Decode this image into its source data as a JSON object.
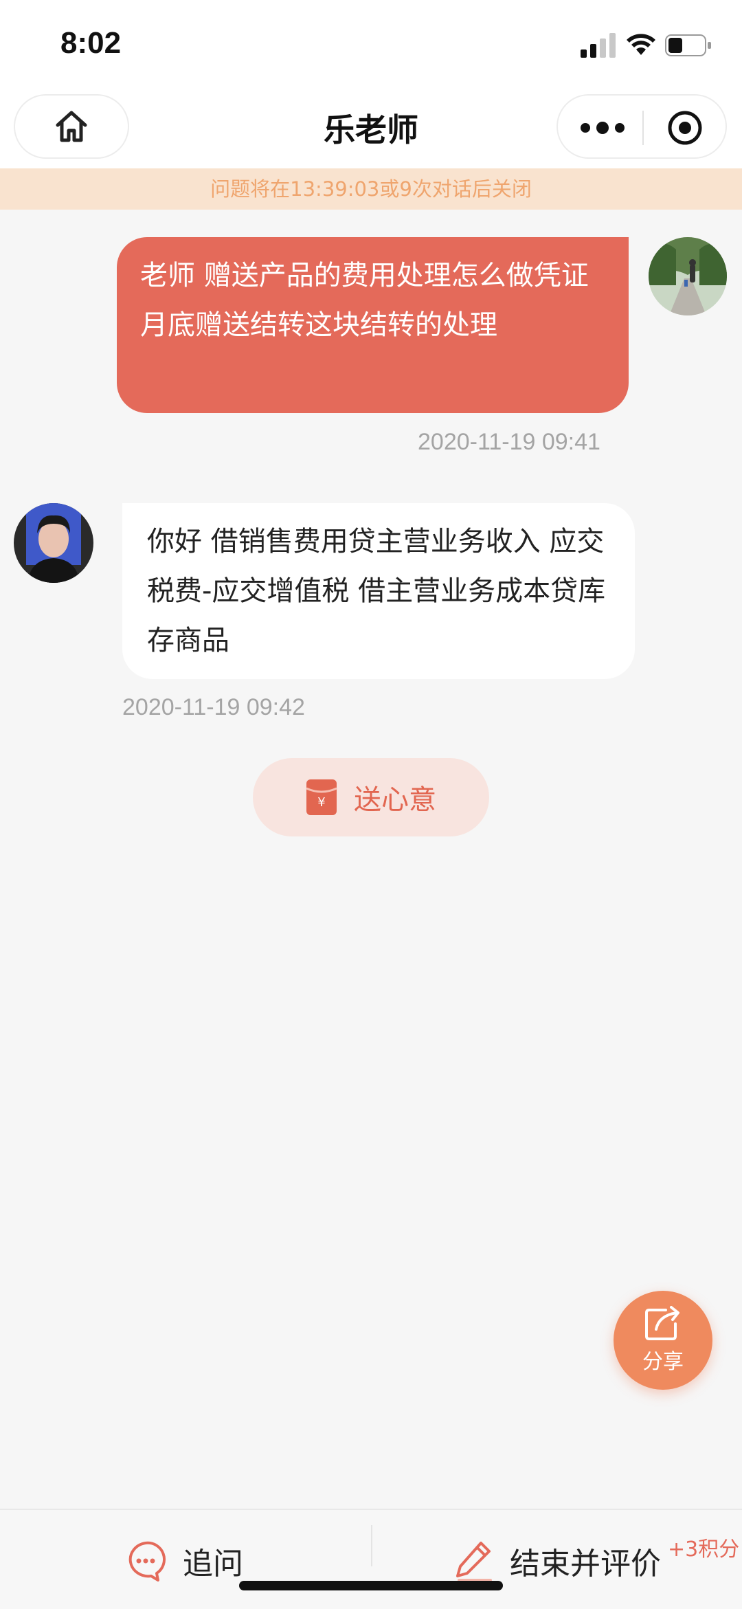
{
  "status_bar": {
    "time": "8:02"
  },
  "nav": {
    "title": "乐老师"
  },
  "notice": {
    "text": "问题将在13:39:03或9次对话后关闭"
  },
  "messages": [
    {
      "sender": "user",
      "text": "老师 赠送产品的费用处理怎么做凭证 月底赠送结转这块结转的处理",
      "time": "2020-11-19 09:41"
    },
    {
      "sender": "teacher",
      "text": " 你好  借销售费用贷主营业务收入  应交税费-应交增值税  借主营业务成本贷库存商品",
      "time": "2020-11-19 09:42"
    }
  ],
  "gift_button": {
    "label": "送心意",
    "icon": "red-envelope-icon"
  },
  "share_button": {
    "label": "分享",
    "icon": "share-icon"
  },
  "bottom_bar": {
    "ask_label": "追问",
    "end_label": "结束并评价",
    "points_label": "+3积分"
  },
  "colors": {
    "accent": "#e46a5a",
    "notice_bg": "#f9e3cf",
    "notice_text": "#efa56e",
    "share": "#ef8a5e"
  }
}
